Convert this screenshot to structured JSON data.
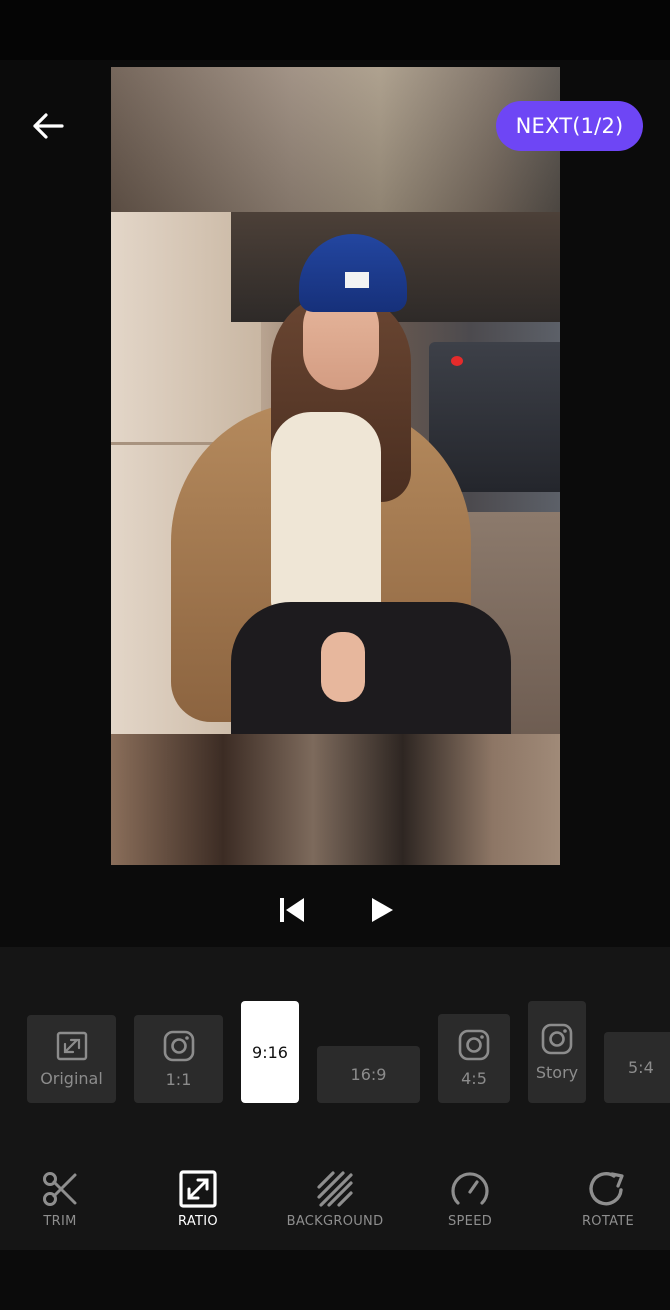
{
  "header": {
    "back_icon": "arrow-left-icon",
    "next_label": "NEXT(1/2)",
    "accent_color": "#6e46f5"
  },
  "playback": {
    "skip_back_icon": "skip-to-start-icon",
    "play_icon": "play-icon"
  },
  "ratios": [
    {
      "label": "Original",
      "icon": "expand-frame-icon",
      "selected": false
    },
    {
      "label": "1:1",
      "icon": "instagram-icon",
      "selected": false
    },
    {
      "label": "9:16",
      "icon": "",
      "selected": true
    },
    {
      "label": "16:9",
      "icon": "",
      "selected": false
    },
    {
      "label": "4:5",
      "icon": "instagram-icon",
      "selected": false
    },
    {
      "label": "Story",
      "icon": "instagram-icon",
      "selected": false
    },
    {
      "label": "5:4",
      "icon": "",
      "selected": false
    }
  ],
  "tools": [
    {
      "label": "TRIM",
      "icon": "scissors-icon",
      "active": false
    },
    {
      "label": "RATIO",
      "icon": "resize-frame-icon",
      "active": true
    },
    {
      "label": "BACKGROUND",
      "icon": "diagonal-lines-icon",
      "active": false
    },
    {
      "label": "SPEED",
      "icon": "speedometer-icon",
      "active": false
    },
    {
      "label": "ROTATE",
      "icon": "rotate-icon",
      "active": false
    }
  ]
}
